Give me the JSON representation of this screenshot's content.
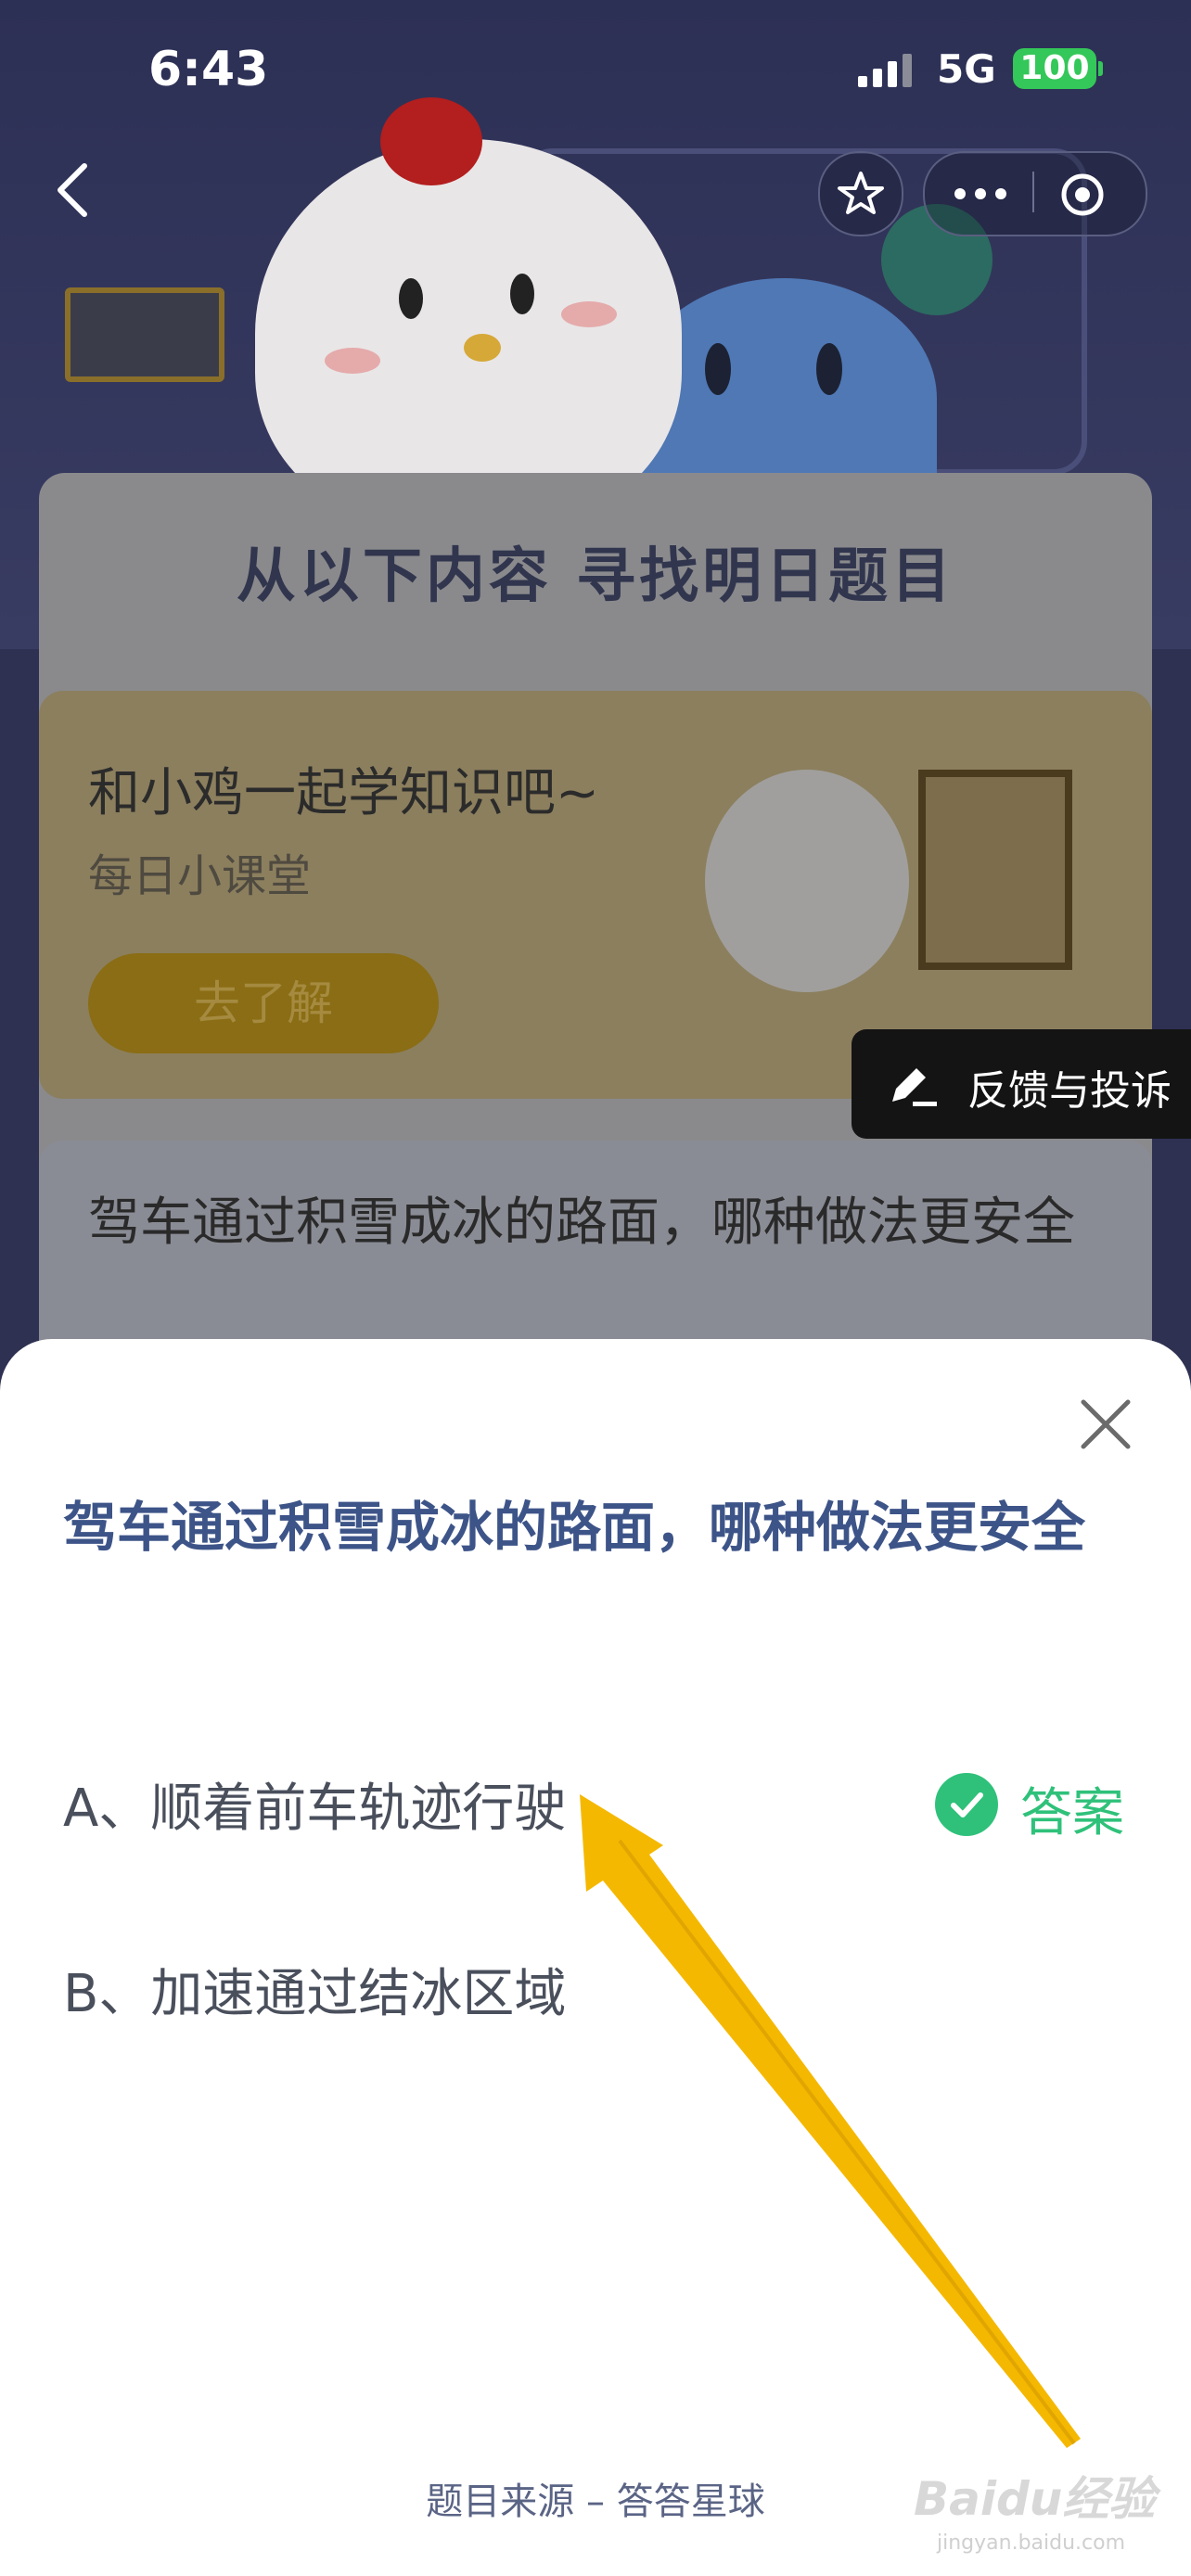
{
  "status_bar": {
    "time": "6:43",
    "network": "5G",
    "battery": "100"
  },
  "background": {
    "heading": "从以下内容  寻找明日题目",
    "course_card": {
      "title": "和小鸡一起学知识吧~",
      "subtitle": "每日小课堂",
      "button": "去了解"
    },
    "question_card_text": "驾车通过积雪成冰的路面，哪种做法更安全"
  },
  "feedback_button": {
    "label": "反馈与投诉"
  },
  "sheet": {
    "question": "驾车通过积雪成冰的路面，哪种做法更安全",
    "options": [
      {
        "label": "A、顺着前车轨迹行驶",
        "is_answer": true
      },
      {
        "label": "B、加速通过结冰区域",
        "is_answer": false
      }
    ],
    "answer_label": "答案",
    "source": "题目来源 – 答答星球"
  },
  "watermark": {
    "text": "Baidu经验",
    "sub": "jingyan.baidu.com"
  },
  "icons": [
    "back-icon",
    "star-icon",
    "more-icon",
    "target-icon",
    "pencil-icon",
    "close-icon",
    "check-icon",
    "signal-icon"
  ],
  "colors": {
    "question_text": "#3d5488",
    "answer_green": "#2fc17a",
    "arrow": "#f5b800"
  }
}
